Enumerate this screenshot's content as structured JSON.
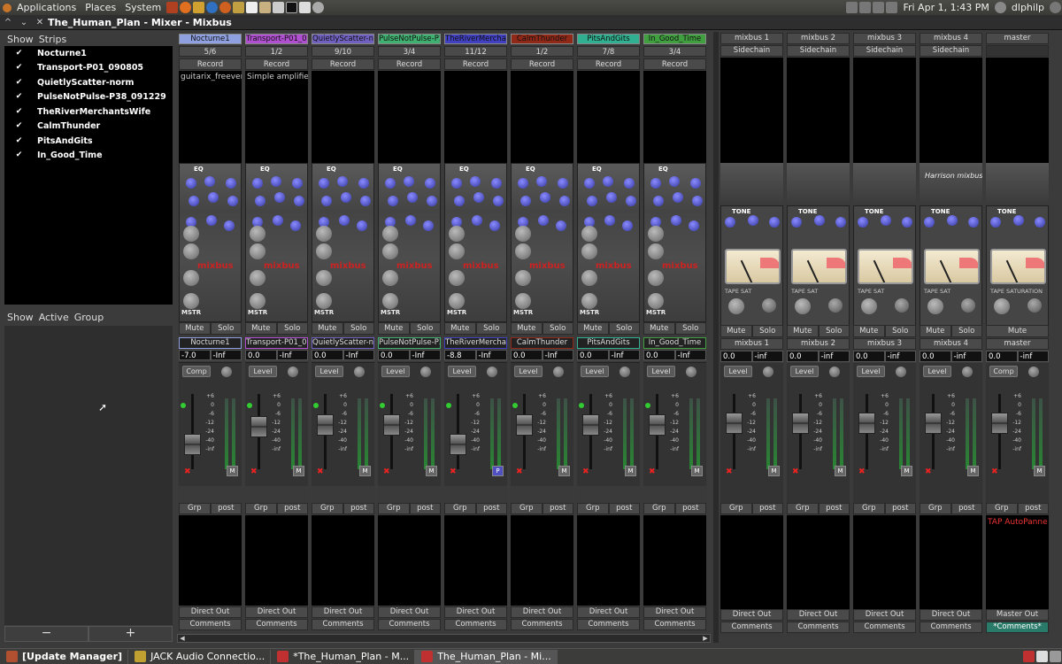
{
  "top_panel": {
    "menus": [
      "Applications",
      "Places",
      "System"
    ],
    "datetime": "Fri Apr  1,  1:43 PM",
    "user": "dlphilp"
  },
  "window": {
    "title": "The_Human_Plan - Mixer - Mixbus"
  },
  "strips_pane": {
    "headers": [
      "Show",
      "Strips"
    ],
    "items": [
      {
        "label": "Nocturne1",
        "checked": true
      },
      {
        "label": "Transport-P01_090805",
        "checked": true
      },
      {
        "label": "QuietlyScatter-norm",
        "checked": true
      },
      {
        "label": "PulseNotPulse-P38_091229",
        "checked": true
      },
      {
        "label": "TheRiverMerchantsWife",
        "checked": true
      },
      {
        "label": "CalmThunder",
        "checked": true
      },
      {
        "label": "PitsAndGits",
        "checked": true
      },
      {
        "label": "In_Good_Time",
        "checked": true
      }
    ]
  },
  "group_pane": {
    "headers": [
      "Show",
      "Active",
      "Group"
    ],
    "minus": "−",
    "plus": "+"
  },
  "strips": [
    {
      "name": "Nocturne1",
      "color": "#8fa0e0",
      "io": "5/6",
      "record": "Record",
      "plugin": "guitarix_freever",
      "mute": "Mute",
      "solo": "Solo",
      "name2": "Nocturne1",
      "gain": "-7.0",
      "peak": "-Inf",
      "dyn": "Comp",
      "btn": "M",
      "grp": "Grp",
      "post": "post",
      "direct": "Direct Out",
      "comments": "Comments"
    },
    {
      "name": "Transport-P01_09",
      "color": "#b050d0",
      "io": "1/2",
      "record": "Record",
      "plugin": "Simple amplifier",
      "mute": "Mute",
      "solo": "Solo",
      "name2": "Transport-P01_09",
      "gain": "0.0",
      "peak": "-Inf",
      "dyn": "Level",
      "btn": "M",
      "grp": "Grp",
      "post": "post",
      "direct": "Direct Out",
      "comments": "Comments"
    },
    {
      "name": "QuietlyScatter-no",
      "color": "#7060c0",
      "io": "9/10",
      "record": "Record",
      "plugin": "",
      "mute": "Mute",
      "solo": "Solo",
      "name2": "QuietlyScatter-no",
      "gain": "0.0",
      "peak": "-Inf",
      "dyn": "Level",
      "btn": "M",
      "grp": "Grp",
      "post": "post",
      "direct": "Direct Out",
      "comments": "Comments"
    },
    {
      "name": "PulseNotPulse-P3",
      "color": "#40b070",
      "io": "3/4",
      "record": "Record",
      "plugin": "",
      "mute": "Mute",
      "solo": "Solo",
      "name2": "PulseNotPulse-P3",
      "gain": "0.0",
      "peak": "-Inf",
      "dyn": "Level",
      "btn": "M",
      "grp": "Grp",
      "post": "post",
      "direct": "Direct Out",
      "comments": "Comments"
    },
    {
      "name": "TheRiverMerchar",
      "color": "#4040c0",
      "io": "11/12",
      "record": "Record",
      "plugin": "",
      "mute": "Mute",
      "solo": "Solo",
      "name2": "TheRiverMerchar",
      "gain": "-8.8",
      "peak": "-Inf",
      "dyn": "Level",
      "btn": "P",
      "grp": "Grp",
      "post": "post",
      "direct": "Direct Out",
      "comments": "Comments"
    },
    {
      "name": "CalmThunder",
      "color": "#902818",
      "io": "1/2",
      "record": "Record",
      "plugin": "",
      "mute": "Mute",
      "solo": "Solo",
      "name2": "CalmThunder",
      "gain": "0.0",
      "peak": "-Inf",
      "dyn": "Level",
      "btn": "M",
      "grp": "Grp",
      "post": "post",
      "direct": "Direct Out",
      "comments": "Comments"
    },
    {
      "name": "PitsAndGits",
      "color": "#30b090",
      "io": "7/8",
      "record": "Record",
      "plugin": "",
      "mute": "Mute",
      "solo": "Solo",
      "name2": "PitsAndGits",
      "gain": "0.0",
      "peak": "-Inf",
      "dyn": "Level",
      "btn": "M",
      "grp": "Grp",
      "post": "post",
      "direct": "Direct Out",
      "comments": "Comments"
    },
    {
      "name": "In_Good_Time",
      "color": "#40a040",
      "io": "3/4",
      "record": "Record",
      "plugin": "",
      "mute": "Mute",
      "solo": "Solo",
      "name2": "In_Good_Time",
      "gain": "0.0",
      "peak": "-Inf",
      "dyn": "Level",
      "btn": "M",
      "grp": "Grp",
      "post": "post",
      "direct": "Direct Out",
      "comments": "Comments"
    }
  ],
  "buses": [
    {
      "name": "mixbus 1",
      "side": "Sidechain",
      "mute": "Mute",
      "solo": "Solo",
      "name2": "mixbus 1",
      "gain": "0.0",
      "peak": "-inf",
      "dyn": "Level",
      "grp": "Grp",
      "post": "post",
      "plugin": "",
      "direct": "Direct Out",
      "comments": "Comments"
    },
    {
      "name": "mixbus 2",
      "side": "Sidechain",
      "mute": "Mute",
      "solo": "Solo",
      "name2": "mixbus 2",
      "gain": "0.0",
      "peak": "-inf",
      "dyn": "Level",
      "grp": "Grp",
      "post": "post",
      "plugin": "",
      "direct": "Direct Out",
      "comments": "Comments"
    },
    {
      "name": "mixbus 3",
      "side": "Sidechain",
      "mute": "Mute",
      "solo": "Solo",
      "name2": "mixbus 3",
      "gain": "0.0",
      "peak": "-inf",
      "dyn": "Level",
      "grp": "Grp",
      "post": "post",
      "plugin": "",
      "direct": "Direct Out",
      "comments": "Comments"
    },
    {
      "name": "mixbus 4",
      "side": "Sidechain",
      "mute": "Mute",
      "solo": "Solo",
      "name2": "mixbus 4",
      "gain": "0.0",
      "peak": "-inf",
      "dyn": "Level",
      "grp": "Grp",
      "post": "post",
      "plugin": "",
      "direct": "Direct Out",
      "comments": "Comments"
    },
    {
      "name": "master",
      "side": "",
      "mute": "Mute",
      "solo": "",
      "name2": "master",
      "gain": "0.0",
      "peak": "-inf",
      "dyn": "Comp",
      "grp": "Grp",
      "post": "post",
      "plugin": "TAP AutoPanne",
      "direct": "Master Out",
      "comments": "*Comments*"
    }
  ],
  "eq_labels": {
    "eq": "EQ",
    "mstr": "MSTR",
    "logo_a": "mi",
    "logo_b": "x",
    "logo_c": "bus",
    "tone": "TONE",
    "tape_sat": "TAPE SAT",
    "tape_saturation": "TAPE SATURATION",
    "brand": "Harrison mixbus"
  },
  "taskbar": {
    "tasks": [
      "[Update Manager]",
      "JACK Audio Connectio...",
      "*The_Human_Plan - M...",
      "The_Human_Plan - Mi..."
    ]
  }
}
